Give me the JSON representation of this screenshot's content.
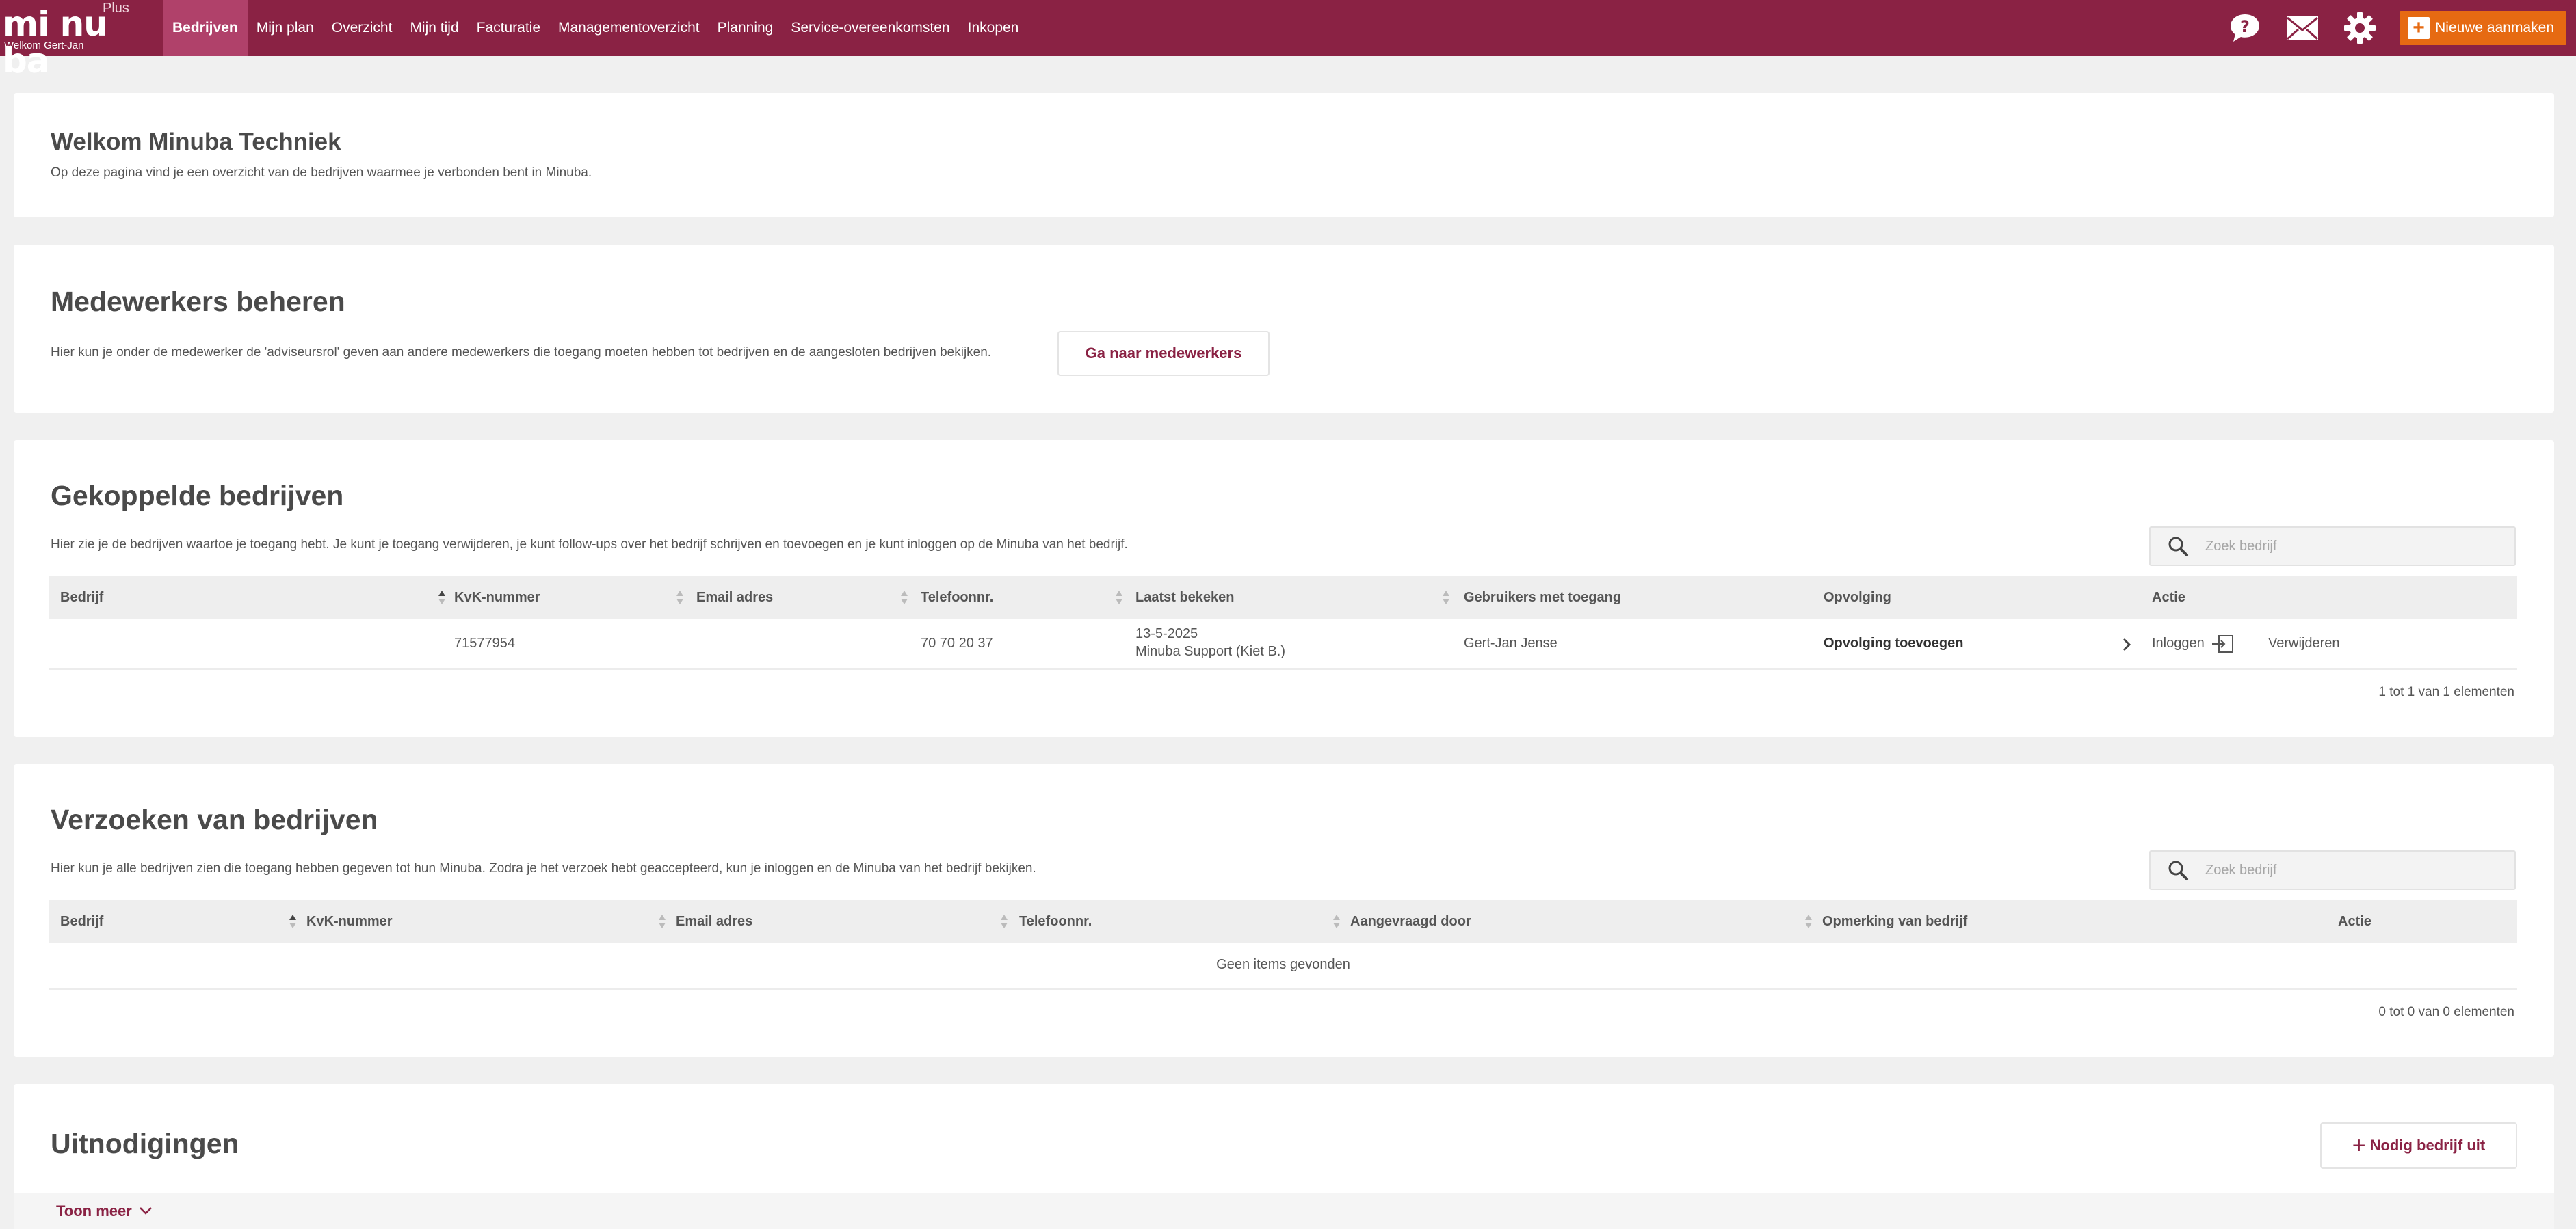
{
  "app": {
    "logo_text": "mi nu ba",
    "logo_badge": "Plus",
    "welcome": "Welkom Gert-Jan"
  },
  "nav": {
    "items": [
      {
        "label": "Bedrijven",
        "active": true
      },
      {
        "label": "Mijn plan"
      },
      {
        "label": "Overzicht"
      },
      {
        "label": "Mijn tijd"
      },
      {
        "label": "Facturatie"
      },
      {
        "label": "Managementoverzicht"
      },
      {
        "label": "Planning"
      },
      {
        "label": "Service-overeenkomsten"
      },
      {
        "label": "Inkopen"
      }
    ],
    "new_button": "Nieuwe aanmaken"
  },
  "icons": {
    "help": "help-icon",
    "mail": "mail-icon",
    "settings": "gear-icon",
    "search": "search-icon"
  },
  "colors": {
    "brand": "#8a2244",
    "nav_active": "#b0416a",
    "accent": "#e66a12"
  },
  "welcome_card": {
    "title": "Welkom Minuba Techniek",
    "description": "Op deze pagina vind je een overzicht van de bedrijven waarmee je verbonden bent in Minuba."
  },
  "employees_card": {
    "title": "Medewerkers beheren",
    "description": "Hier kun je onder de medewerker de 'adviseursrol' geven aan andere medewerkers die toegang moeten hebben tot bedrijven en de aangesloten bedrijven bekijken.",
    "button": "Ga naar medewerkers"
  },
  "linked_card": {
    "title": "Gekoppelde bedrijven",
    "description": "Hier zie je de bedrijven waartoe je toegang hebt. Je kunt je toegang verwijderen, je kunt follow-ups over het bedrijf schrijven en toevoegen en je kunt inloggen op de Minuba van het bedrijf.",
    "search_placeholder": "Zoek bedrijf",
    "columns": [
      "Bedrijf",
      "KvK-nummer",
      "Email adres",
      "Telefoonnr.",
      "Laatst bekeken",
      "Gebruikers met toegang",
      "Opvolging",
      "Actie"
    ],
    "rows": [
      {
        "company": "",
        "kvk": "71577954",
        "email": "",
        "phone": "70 70 20 37",
        "last_viewed_date": "13-5-2025",
        "last_viewed_by": "Minuba Support (Kiet B.)",
        "users": "Gert-Jan Jense",
        "followup": "Opvolging toevoegen",
        "login": "Inloggen",
        "remove": "Verwijderen"
      }
    ],
    "pager": "1 tot 1 van 1 elementen"
  },
  "requests_card": {
    "title": "Verzoeken van bedrijven",
    "description": "Hier kun je alle bedrijven zien die toegang hebben gegeven tot hun Minuba. Zodra je het verzoek hebt geaccepteerd, kun je inloggen en de Minuba van het bedrijf bekijken.",
    "search_placeholder": "Zoek bedrijf",
    "columns": [
      "Bedrijf",
      "KvK-nummer",
      "Email adres",
      "Telefoonnr.",
      "Aangevraagd door",
      "Opmerking van bedrijf",
      "Actie"
    ],
    "empty": "Geen items gevonden",
    "pager": "0 tot 0 van 0 elementen"
  },
  "invites_card": {
    "title": "Uitnodigingen",
    "button": "Nodig bedrijf uit",
    "show_more": "Toon meer"
  }
}
